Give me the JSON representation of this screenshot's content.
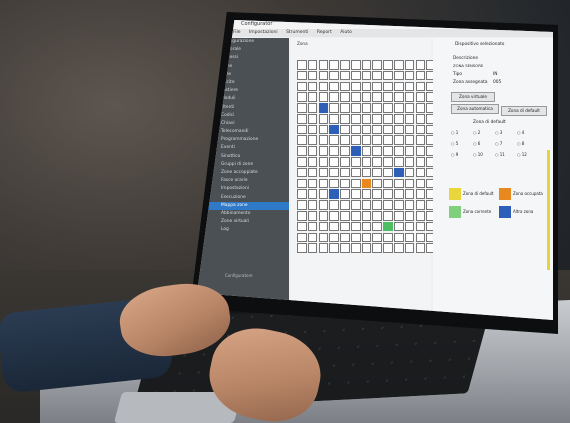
{
  "window": {
    "title": "Configurator"
  },
  "menu": [
    "File",
    "Impostazioni",
    "Strumenti",
    "Report",
    "Aiuto"
  ],
  "sidebar": {
    "items": [
      "Configurazione",
      "Generale",
      "Ingressi",
      "Zone",
      "Aree",
      "Uscite",
      "Tastiere",
      "Moduli",
      "Utenti",
      "Codici",
      "Chiavi",
      "Telecomandi",
      "Programmazione",
      "Eventi",
      "Sinottico",
      "Gruppi di zone",
      "Zone accoppiate",
      "Fasce orarie",
      "Impostazioni",
      "Esecuzione",
      "Mappa zone",
      "Abbinamento",
      "Zone virtuali",
      "Log"
    ],
    "active_index": 20,
    "status": "Configuratore"
  },
  "grid": {
    "header": "Zona",
    "rows": 18,
    "cols": 13,
    "highlighted": [
      {
        "row": 4,
        "col": 2,
        "color": "#2d5fb9"
      },
      {
        "row": 6,
        "col": 3,
        "color": "#2d5fb9"
      },
      {
        "row": 8,
        "col": 5,
        "color": "#2d5fb9"
      },
      {
        "row": 10,
        "col": 9,
        "color": "#2d5fb9"
      },
      {
        "row": 11,
        "col": 6,
        "color": "#e8891f"
      },
      {
        "row": 12,
        "col": 3,
        "color": "#2d5fb9"
      },
      {
        "row": 15,
        "col": 8,
        "color": "#4dbd63"
      }
    ]
  },
  "panel": {
    "title": "Dispositivo selezionato",
    "description_label": "Descrizione",
    "description_value": "ZONA SENSORE",
    "type_label": "Tipo",
    "type_value": "IN",
    "zone_label": "Zona assegnata",
    "zone_value": "005",
    "btn_zone_virtuali": "Zona virtuale",
    "btn_zona_automatica": "Zona automatica",
    "btn_zona_default": "Zona di default",
    "radio_group_title": "Zona di default",
    "radios": [
      "1",
      "2",
      "3",
      "4",
      "5",
      "6",
      "7",
      "8",
      "9",
      "10",
      "11",
      "12"
    ]
  },
  "legend": [
    {
      "label": "Zona di default",
      "color": "#e8d63b"
    },
    {
      "label": "Zona occupata",
      "color": "#e8891f"
    },
    {
      "label": "Zona corrente",
      "color": "#7fcf7c"
    },
    {
      "label": "Altra zona",
      "color": "#2d5fb9"
    }
  ]
}
